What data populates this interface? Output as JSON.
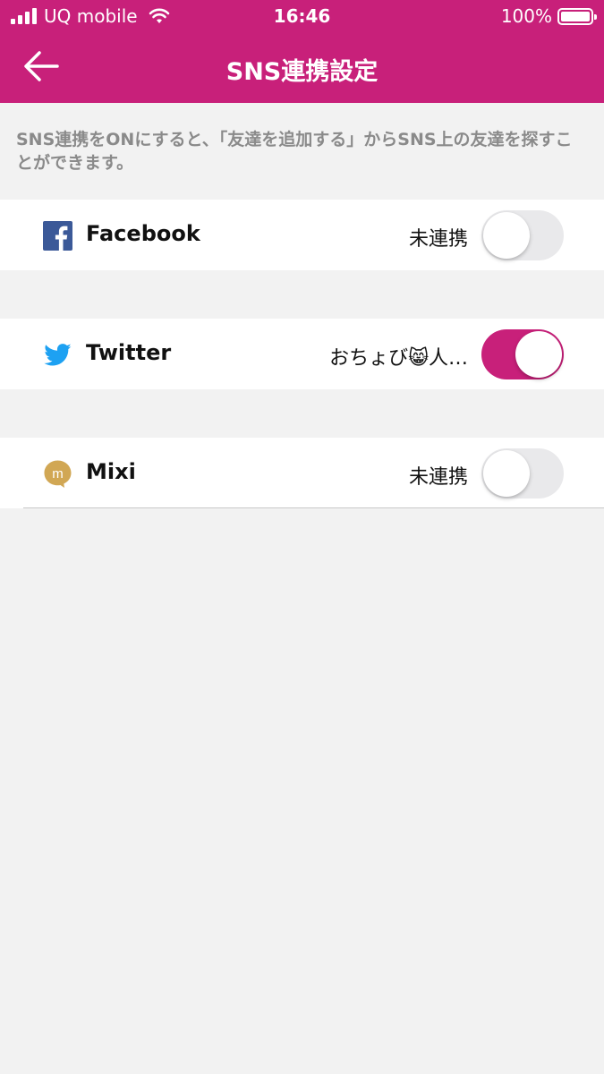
{
  "status_bar": {
    "carrier": "UQ mobile",
    "time": "16:46",
    "battery": "100%"
  },
  "nav": {
    "title": "SNS連携設定",
    "back_icon": "arrow-left-icon"
  },
  "description": "SNS連携をONにすると、「友達を追加する」からSNS上の友達を探すことができます。",
  "accounts": [
    {
      "name": "Facebook",
      "icon": "facebook-icon",
      "status": "未連携",
      "enabled": false
    },
    {
      "name": "Twitter",
      "icon": "twitter-icon",
      "status": "おちょび😸人…",
      "enabled": true
    },
    {
      "name": "Mixi",
      "icon": "mixi-icon",
      "status": "未連携",
      "enabled": false
    }
  ],
  "colors": {
    "accent": "#c8207a",
    "facebook": "#3b5998",
    "twitter": "#1da1f2",
    "mixi": "#d1a754"
  }
}
